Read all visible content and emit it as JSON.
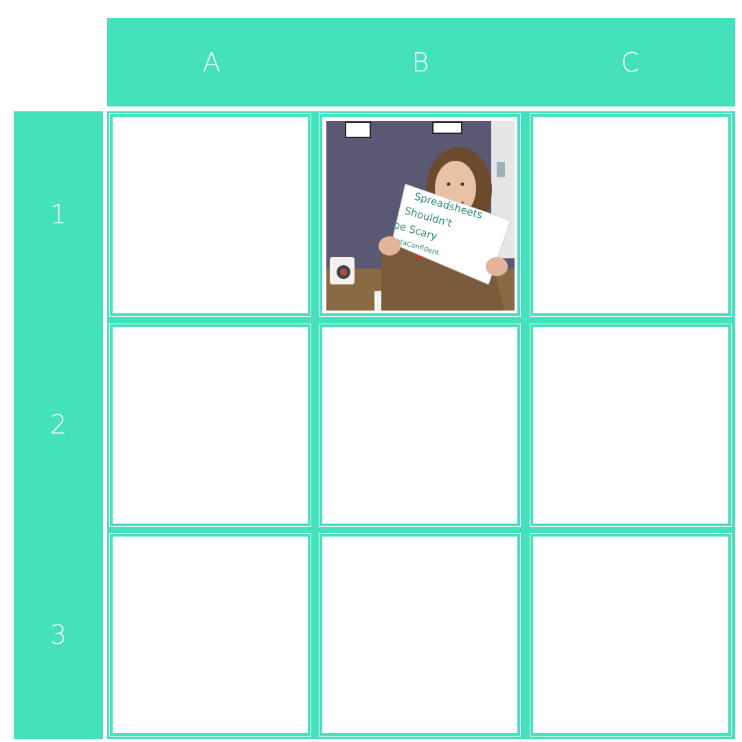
{
  "columns": [
    "A",
    "B",
    "C"
  ],
  "rows": [
    "1",
    "2",
    "3"
  ],
  "colors": {
    "accent": "#45e1bd",
    "label": "#ffffff",
    "cell_bg": "#ffffff"
  },
  "photo": {
    "cell": "B1",
    "sign_lines": [
      "Spreadsheets",
      "Shouldn't",
      "be Scary",
      "#DataConfident"
    ]
  }
}
